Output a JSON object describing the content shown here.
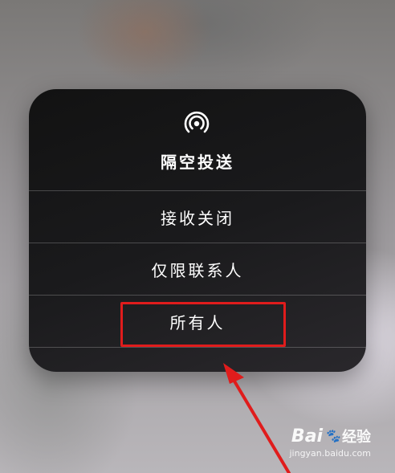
{
  "airdrop": {
    "icon": "airdrop-icon",
    "title": "隔空投送",
    "options": [
      {
        "label": "接收关闭"
      },
      {
        "label": "仅限联系人"
      },
      {
        "label": "所有人"
      }
    ]
  },
  "annotation": {
    "highlight_color": "#e01c1c"
  },
  "watermark": {
    "brand": "Bai",
    "brand_paw": "du",
    "brand_cn": "经验",
    "url": "jingyan.baidu.com"
  }
}
